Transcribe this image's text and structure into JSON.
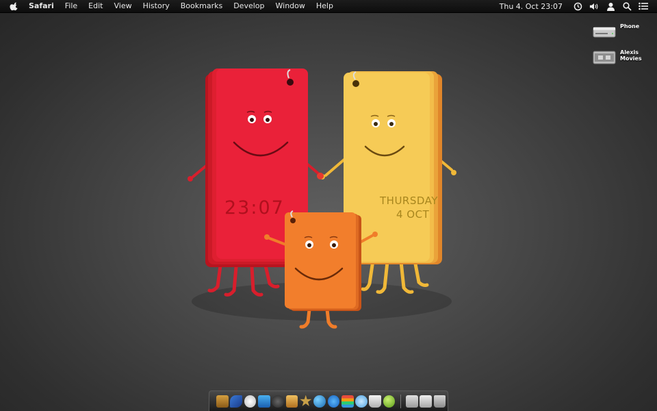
{
  "menubar": {
    "apple_icon": "apple-logo-icon",
    "app_name": "Safari",
    "menus": [
      "File",
      "Edit",
      "View",
      "History",
      "Bookmarks",
      "Develop",
      "Window",
      "Help"
    ],
    "clock": "Thu 4. Oct  23:07",
    "tray_icons": [
      "time-machine-icon",
      "volume-icon",
      "user-icon",
      "spotlight-search-icon",
      "notification-list-icon"
    ]
  },
  "desktop": {
    "icons": [
      {
        "label": "Phone",
        "icon": "hard-drive-icon"
      },
      {
        "label": "Alexis Movies",
        "icon": "external-drive-icon"
      }
    ]
  },
  "wallpaper": {
    "time_text": "23:07",
    "day_text": "THURSDAY",
    "date_text": "4 OCT",
    "colors": {
      "red": "#e8203a",
      "yellow": "#f4c84a",
      "orange": "#f07d2a"
    }
  },
  "dock": {
    "items": [
      "photo-booth-icon",
      "feather-icon",
      "safari-compass-icon",
      "itunes-icon",
      "camera-icon",
      "mail-stamp-icon",
      "star-icon",
      "globe-icon",
      "app-store-icon",
      "apple-store-icon",
      "messages-icon",
      "coffee-cup-icon",
      "green-ball-icon"
    ],
    "stack_items": [
      "documents-stack-icon",
      "downloads-stack-icon",
      "trash-icon"
    ]
  }
}
